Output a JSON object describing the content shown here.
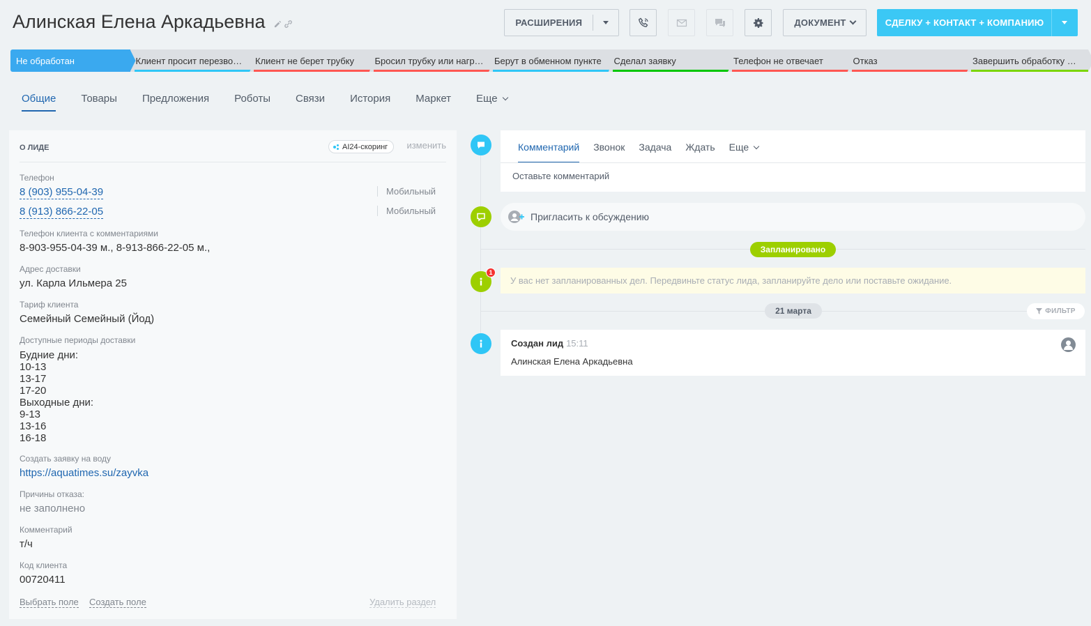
{
  "header": {
    "title": "Алинская Елена  Аркадьевна",
    "extensions_label": "РАСШИРЕНИЯ",
    "document_label": "ДОКУМЕНТ",
    "convert_label": "СДЕЛКУ + КОНТАКТ + КОМПАНИЮ"
  },
  "stages": [
    {
      "label": "Не обработан",
      "color": "#3aa9ef",
      "active": true
    },
    {
      "label": "Клиент просит перезвонить",
      "color": "#2fc6f6"
    },
    {
      "label": "Клиент не берет трубку",
      "color": "#ff5752"
    },
    {
      "label": "Бросил трубку или нагрубил",
      "color": "#ff5752"
    },
    {
      "label": "Берут в обменном пункте",
      "color": "#2fc6f6"
    },
    {
      "label": "Сделал заявку",
      "color": "#00c600"
    },
    {
      "label": "Телефон не отвечает",
      "color": "#ff5752"
    },
    {
      "label": "Отказ",
      "color": "#ff5752"
    },
    {
      "label": "Завершить обработку лида",
      "color": "#7bd500"
    }
  ],
  "tabs": [
    "Общие",
    "Товары",
    "Предложения",
    "Роботы",
    "Связи",
    "История",
    "Маркет",
    "Еще"
  ],
  "lead": {
    "section_title": "О ЛИДЕ",
    "ai_badge": "AI24-скоринг",
    "change_label": "изменить",
    "phone_label": "Телефон",
    "phones": [
      {
        "number": "8 (903) 955-04-39",
        "type": "Мобильный"
      },
      {
        "number": "8 (913) 866-22-05",
        "type": "Мобильный"
      }
    ],
    "phone_comments_label": "Телефон клиента с комментариями",
    "phone_comments_value": "8-903-955-04-39 м., 8-913-866-22-05 м.,",
    "address_label": "Адрес доставки",
    "address_value": "ул. Карла Ильмера 25",
    "tariff_label": "Тариф клиента",
    "tariff_value": "Семейный Семейный (Йод)",
    "periods_label": "Доступные периоды доставки",
    "periods_lines": [
      "Будние дни:",
      "10-13",
      "13-17",
      "17-20",
      "Выходные дни:",
      "9-13",
      "13-16",
      "16-18"
    ],
    "order_label": "Создать заявку на воду",
    "order_url": "https://aquatimes.su/zayvka",
    "reasons_label": "Причины отказа:",
    "reasons_value": "не заполнено",
    "comment_label": "Комментарий",
    "comment_value": "т/ч",
    "code_label": "Код клиента",
    "code_value": "00720411",
    "select_field": "Выбрать поле",
    "create_field": "Создать поле",
    "delete_section": "Удалить раздел"
  },
  "timeline": {
    "editor_tabs": [
      "Комментарий",
      "Звонок",
      "Задача",
      "Ждать",
      "Еще"
    ],
    "comment_placeholder": "Оставьте комментарий",
    "invite_label": "Пригласить к обсуждению",
    "planned_label": "Запланировано",
    "no_plans_text": "У вас нет запланированных дел. Передвиньте статус лида, запланируйте дело или поставьте ожидание.",
    "notification_count": "1",
    "date_label": "21 марта",
    "filter_label": "ФИЛЬТР",
    "event_title": "Создан лид",
    "event_time": "15:11",
    "event_name": "Алинская Елена Аркадьевна"
  },
  "colors": {
    "accent": "#2067b0",
    "convert_button": "#3bc8f5",
    "planned_pill": "#9dcf00",
    "timeline_blue": "#2fc6f6",
    "timeline_green": "#9dcf00"
  }
}
